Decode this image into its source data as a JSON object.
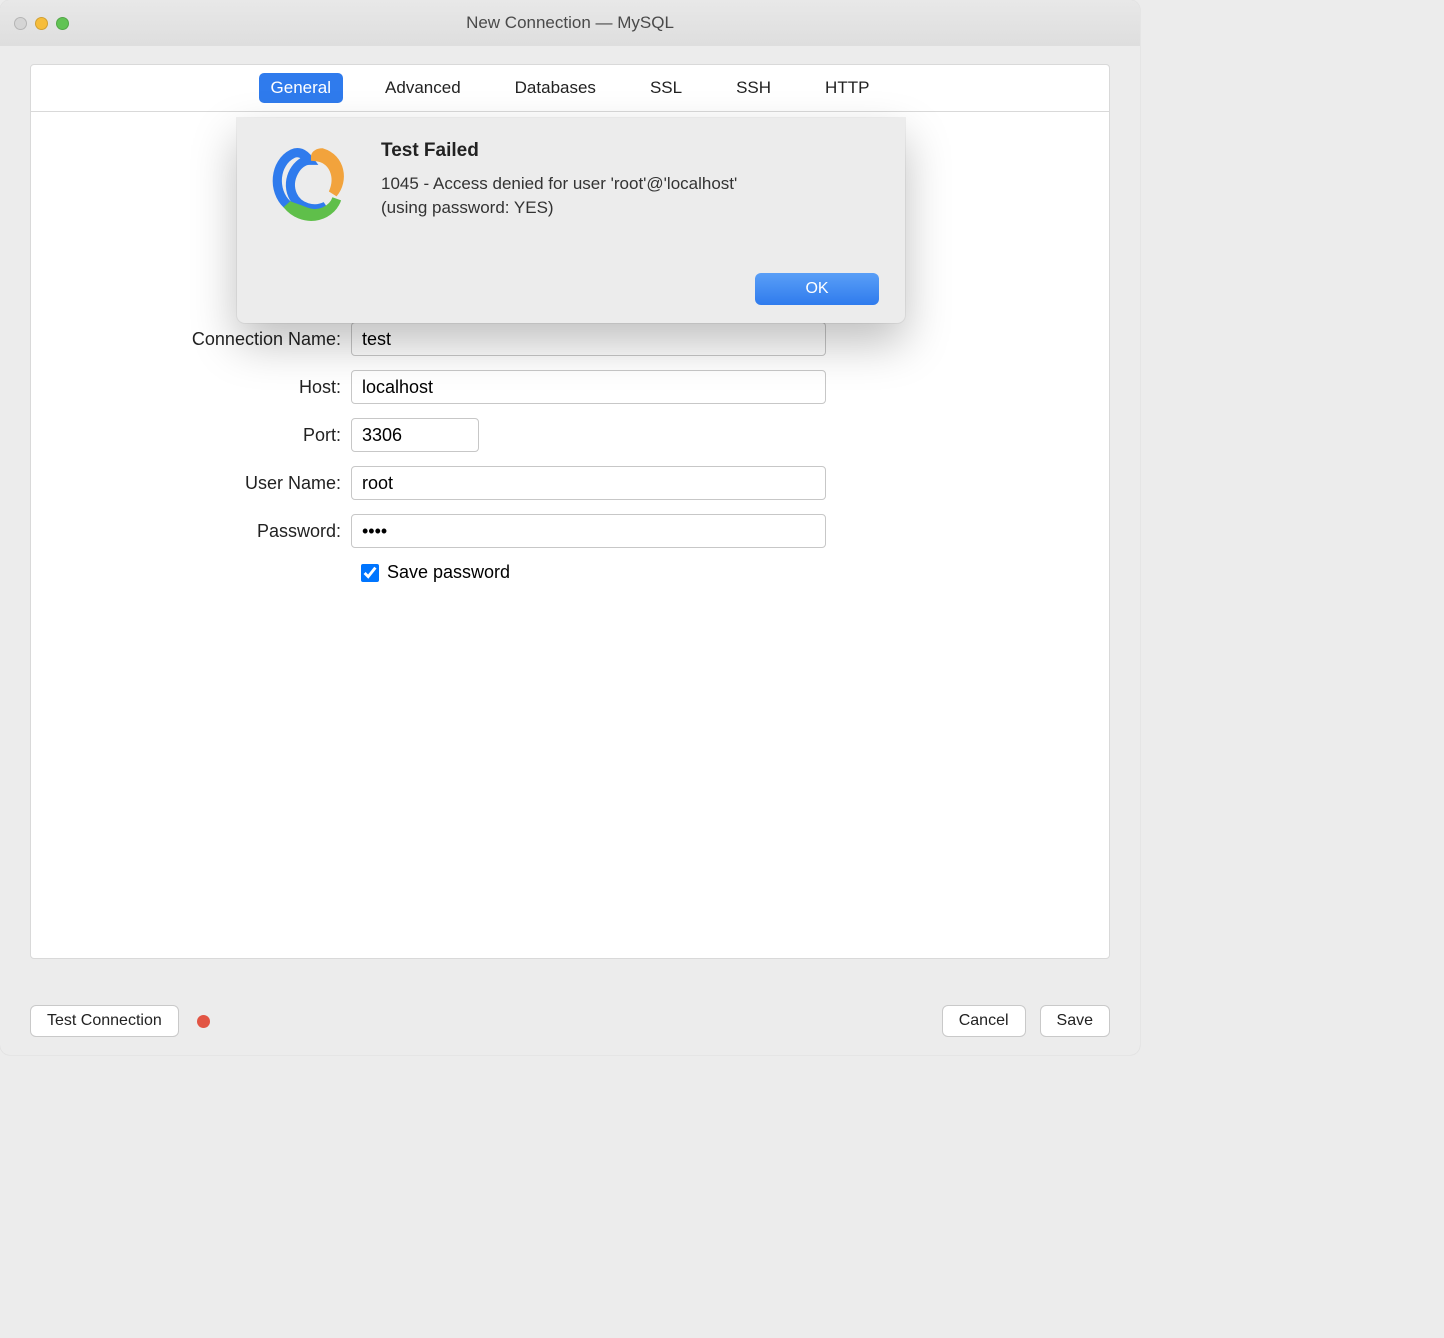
{
  "window": {
    "title": "New Connection — MySQL"
  },
  "tabs": {
    "general": "General",
    "advanced": "Advanced",
    "databases": "Databases",
    "ssl": "SSL",
    "ssh": "SSH",
    "http": "HTTP"
  },
  "form": {
    "connection_name_label": "Connection Name:",
    "connection_name_value": "test",
    "host_label": "Host:",
    "host_value": "localhost",
    "port_label": "Port:",
    "port_value": "3306",
    "user_label": "User Name:",
    "user_value": "root",
    "password_label": "Password:",
    "password_value": "••••",
    "save_password_label": "Save password"
  },
  "footer": {
    "test_connection": "Test Connection",
    "cancel": "Cancel",
    "save": "Save"
  },
  "modal": {
    "title": "Test Failed",
    "message": "1045 - Access denied for user 'root'@'localhost' (using password: YES)",
    "ok": "OK"
  }
}
